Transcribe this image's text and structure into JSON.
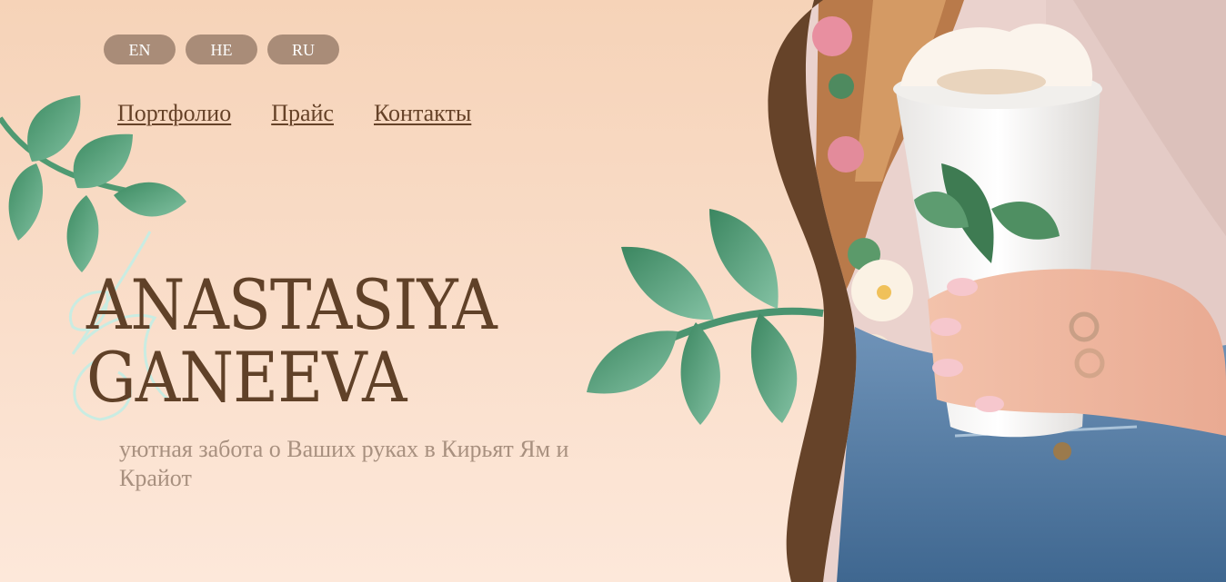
{
  "languages": [
    "EN",
    "HE",
    "RU"
  ],
  "nav": {
    "portfolio": "Портфолио",
    "price": "Прайс",
    "contacts": "Контакты"
  },
  "hero": {
    "name_line1": "ANASTASIYA",
    "name_line2": "GANEEVA",
    "tagline": "уютная забота о Ваших руках в Кирьят Ям и Крайот"
  },
  "colors": {
    "background_top": "#f6d3b8",
    "background_bottom": "#fde8da",
    "lang_button": "#a98c78",
    "brown_accent": "#604128",
    "leaf_green": "#4e9a74",
    "tagline": "#a8907f"
  },
  "icons": [
    "leaf-branch-icon",
    "monogram-icon"
  ],
  "photo": {
    "subject": "hand-holding-latte-cup"
  }
}
